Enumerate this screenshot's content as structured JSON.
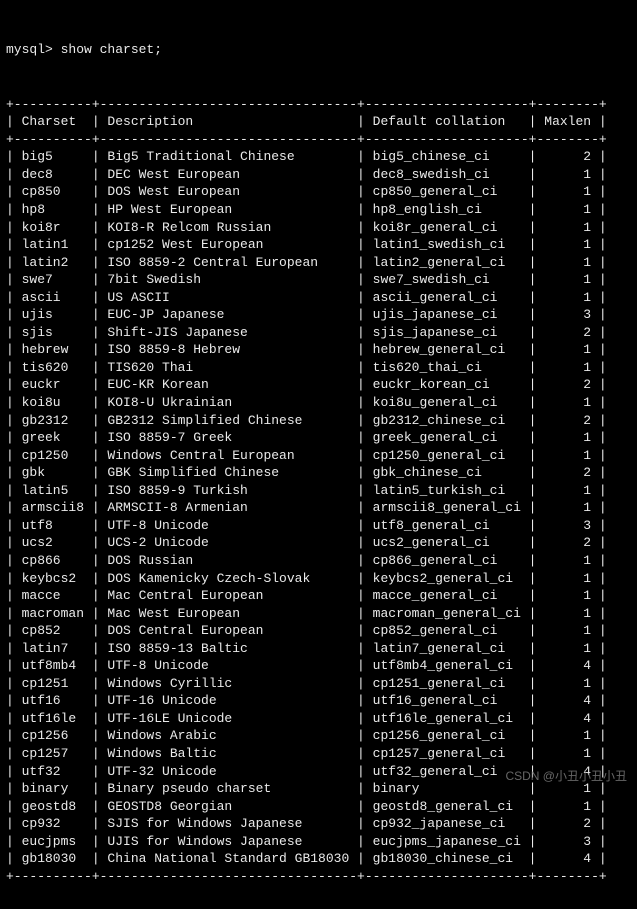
{
  "prompt": "mysql> show charset;",
  "columns": [
    "Charset",
    "Description",
    "Default collation",
    "Maxlen"
  ],
  "rows": [
    {
      "charset": "big5",
      "description": "Big5 Traditional Chinese",
      "collation": "big5_chinese_ci",
      "maxlen": "2"
    },
    {
      "charset": "dec8",
      "description": "DEC West European",
      "collation": "dec8_swedish_ci",
      "maxlen": "1"
    },
    {
      "charset": "cp850",
      "description": "DOS West European",
      "collation": "cp850_general_ci",
      "maxlen": "1"
    },
    {
      "charset": "hp8",
      "description": "HP West European",
      "collation": "hp8_english_ci",
      "maxlen": "1"
    },
    {
      "charset": "koi8r",
      "description": "KOI8-R Relcom Russian",
      "collation": "koi8r_general_ci",
      "maxlen": "1"
    },
    {
      "charset": "latin1",
      "description": "cp1252 West European",
      "collation": "latin1_swedish_ci",
      "maxlen": "1"
    },
    {
      "charset": "latin2",
      "description": "ISO 8859-2 Central European",
      "collation": "latin2_general_ci",
      "maxlen": "1"
    },
    {
      "charset": "swe7",
      "description": "7bit Swedish",
      "collation": "swe7_swedish_ci",
      "maxlen": "1"
    },
    {
      "charset": "ascii",
      "description": "US ASCII",
      "collation": "ascii_general_ci",
      "maxlen": "1"
    },
    {
      "charset": "ujis",
      "description": "EUC-JP Japanese",
      "collation": "ujis_japanese_ci",
      "maxlen": "3"
    },
    {
      "charset": "sjis",
      "description": "Shift-JIS Japanese",
      "collation": "sjis_japanese_ci",
      "maxlen": "2"
    },
    {
      "charset": "hebrew",
      "description": "ISO 8859-8 Hebrew",
      "collation": "hebrew_general_ci",
      "maxlen": "1"
    },
    {
      "charset": "tis620",
      "description": "TIS620 Thai",
      "collation": "tis620_thai_ci",
      "maxlen": "1"
    },
    {
      "charset": "euckr",
      "description": "EUC-KR Korean",
      "collation": "euckr_korean_ci",
      "maxlen": "2"
    },
    {
      "charset": "koi8u",
      "description": "KOI8-U Ukrainian",
      "collation": "koi8u_general_ci",
      "maxlen": "1"
    },
    {
      "charset": "gb2312",
      "description": "GB2312 Simplified Chinese",
      "collation": "gb2312_chinese_ci",
      "maxlen": "2"
    },
    {
      "charset": "greek",
      "description": "ISO 8859-7 Greek",
      "collation": "greek_general_ci",
      "maxlen": "1"
    },
    {
      "charset": "cp1250",
      "description": "Windows Central European",
      "collation": "cp1250_general_ci",
      "maxlen": "1"
    },
    {
      "charset": "gbk",
      "description": "GBK Simplified Chinese",
      "collation": "gbk_chinese_ci",
      "maxlen": "2"
    },
    {
      "charset": "latin5",
      "description": "ISO 8859-9 Turkish",
      "collation": "latin5_turkish_ci",
      "maxlen": "1"
    },
    {
      "charset": "armscii8",
      "description": "ARMSCII-8 Armenian",
      "collation": "armscii8_general_ci",
      "maxlen": "1"
    },
    {
      "charset": "utf8",
      "description": "UTF-8 Unicode",
      "collation": "utf8_general_ci",
      "maxlen": "3"
    },
    {
      "charset": "ucs2",
      "description": "UCS-2 Unicode",
      "collation": "ucs2_general_ci",
      "maxlen": "2"
    },
    {
      "charset": "cp866",
      "description": "DOS Russian",
      "collation": "cp866_general_ci",
      "maxlen": "1"
    },
    {
      "charset": "keybcs2",
      "description": "DOS Kamenicky Czech-Slovak",
      "collation": "keybcs2_general_ci",
      "maxlen": "1"
    },
    {
      "charset": "macce",
      "description": "Mac Central European",
      "collation": "macce_general_ci",
      "maxlen": "1"
    },
    {
      "charset": "macroman",
      "description": "Mac West European",
      "collation": "macroman_general_ci",
      "maxlen": "1"
    },
    {
      "charset": "cp852",
      "description": "DOS Central European",
      "collation": "cp852_general_ci",
      "maxlen": "1"
    },
    {
      "charset": "latin7",
      "description": "ISO 8859-13 Baltic",
      "collation": "latin7_general_ci",
      "maxlen": "1"
    },
    {
      "charset": "utf8mb4",
      "description": "UTF-8 Unicode",
      "collation": "utf8mb4_general_ci",
      "maxlen": "4"
    },
    {
      "charset": "cp1251",
      "description": "Windows Cyrillic",
      "collation": "cp1251_general_ci",
      "maxlen": "1"
    },
    {
      "charset": "utf16",
      "description": "UTF-16 Unicode",
      "collation": "utf16_general_ci",
      "maxlen": "4"
    },
    {
      "charset": "utf16le",
      "description": "UTF-16LE Unicode",
      "collation": "utf16le_general_ci",
      "maxlen": "4"
    },
    {
      "charset": "cp1256",
      "description": "Windows Arabic",
      "collation": "cp1256_general_ci",
      "maxlen": "1"
    },
    {
      "charset": "cp1257",
      "description": "Windows Baltic",
      "collation": "cp1257_general_ci",
      "maxlen": "1"
    },
    {
      "charset": "utf32",
      "description": "UTF-32 Unicode",
      "collation": "utf32_general_ci",
      "maxlen": "4"
    },
    {
      "charset": "binary",
      "description": "Binary pseudo charset",
      "collation": "binary",
      "maxlen": "1"
    },
    {
      "charset": "geostd8",
      "description": "GEOSTD8 Georgian",
      "collation": "geostd8_general_ci",
      "maxlen": "1"
    },
    {
      "charset": "cp932",
      "description": "SJIS for Windows Japanese",
      "collation": "cp932_japanese_ci",
      "maxlen": "2"
    },
    {
      "charset": "eucjpms",
      "description": "UJIS for Windows Japanese",
      "collation": "eucjpms_japanese_ci",
      "maxlen": "3"
    },
    {
      "charset": "gb18030",
      "description": "China National Standard GB18030",
      "collation": "gb18030_chinese_ci",
      "maxlen": "4"
    }
  ],
  "watermark": "CSDN @小丑小丑小丑"
}
